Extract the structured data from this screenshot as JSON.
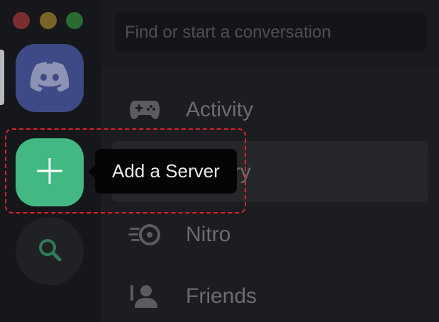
{
  "window_controls": {
    "close_color": "#7a2f2f",
    "minimize_color": "#7a6326",
    "maximize_color": "#2a6a33"
  },
  "search": {
    "placeholder": "Find or start a conversation"
  },
  "servers": {
    "home_icon": "discord-logo-icon",
    "add_server_icon": "plus-icon",
    "explore_icon": "search-icon"
  },
  "nav": {
    "items": [
      {
        "label": "Activity",
        "icon": "gamepad-icon"
      },
      {
        "label": "Library",
        "icon": "library-icon"
      },
      {
        "label": "Nitro",
        "icon": "nitro-icon"
      },
      {
        "label": "Friends",
        "icon": "friends-icon"
      }
    ]
  },
  "tooltip": {
    "text": "Add a Server"
  },
  "colors": {
    "accent_green": "#42b883",
    "blurple": "#3d4a86",
    "highlight_red": "#e0202a"
  }
}
